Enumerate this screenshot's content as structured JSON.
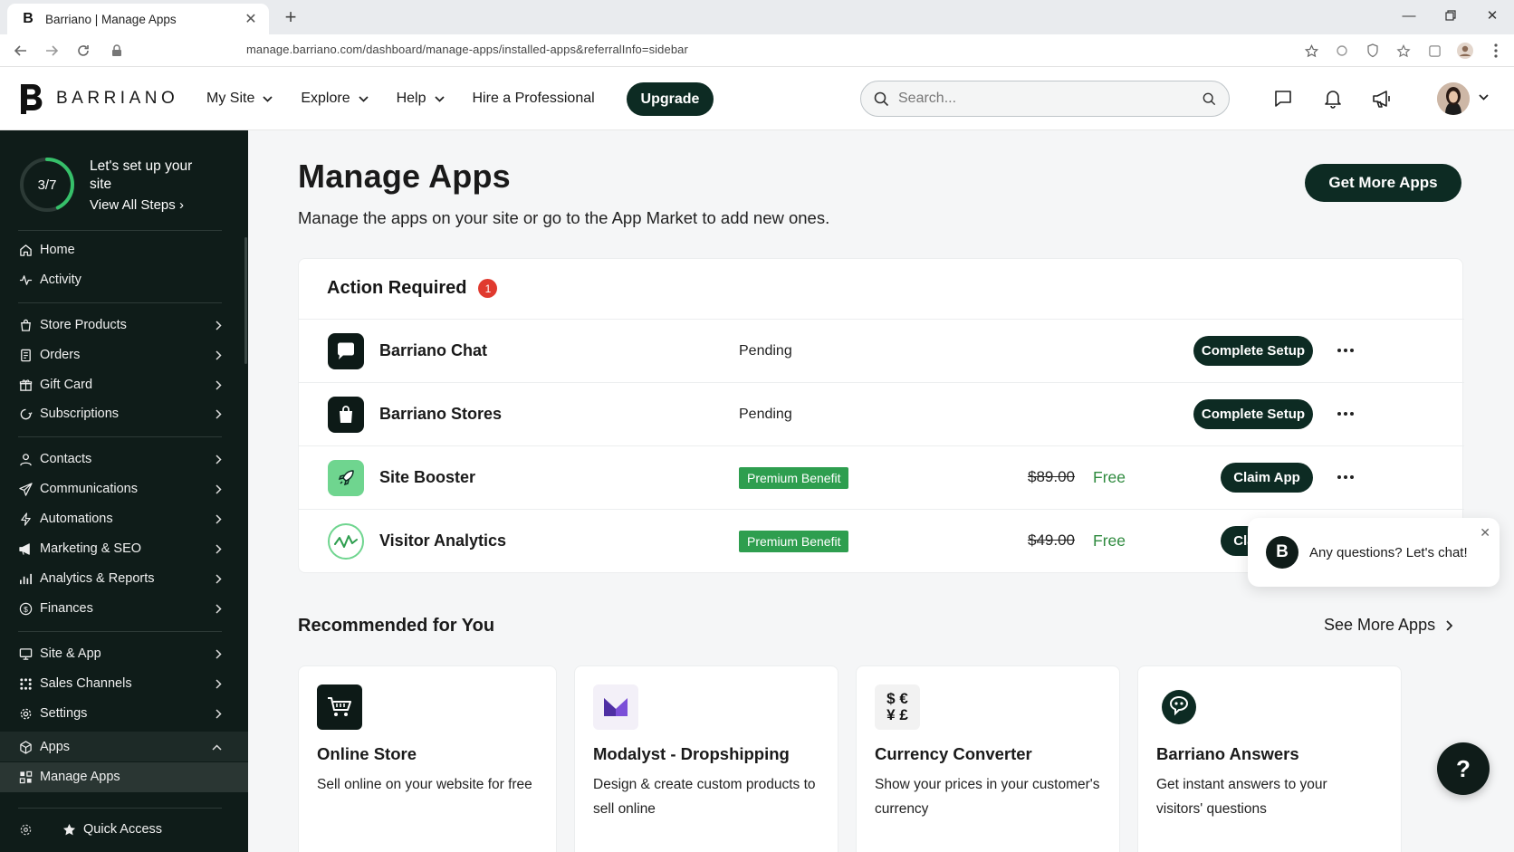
{
  "browser": {
    "tab_title": "Barriano | Manage Apps",
    "tab_favicon": "B",
    "url": "manage.barriano.com/dashboard/manage-apps/installed-apps&referralInfo=sidebar",
    "new_tab": "+"
  },
  "header": {
    "logo_text": "BARRIANO",
    "nav": [
      {
        "label": "My Site",
        "has_chevron": true
      },
      {
        "label": "Explore",
        "has_chevron": true
      },
      {
        "label": "Help",
        "has_chevron": true
      },
      {
        "label": "Hire a Professional",
        "has_chevron": false
      }
    ],
    "upgrade_label": "Upgrade",
    "search_placeholder": "Search..."
  },
  "sidebar": {
    "progress_text": "3/7",
    "progress_fraction": 0.43,
    "setup_title": "Let's set up your site",
    "setup_link": "View All Steps",
    "items": [
      {
        "label": "Home",
        "icon": "home-icon"
      },
      {
        "label": "Activity",
        "icon": "activity-icon"
      },
      {
        "label": "Store Products",
        "icon": "bag-icon"
      },
      {
        "label": "Orders",
        "icon": "receipt-icon"
      },
      {
        "label": "Gift Card",
        "icon": "gift-icon"
      },
      {
        "label": "Subscriptions",
        "icon": "refresh-icon"
      },
      {
        "label": "Contacts",
        "icon": "person-icon"
      },
      {
        "label": "Communications",
        "icon": "send-icon"
      },
      {
        "label": "Automations",
        "icon": "bolt-icon"
      },
      {
        "label": "Marketing & SEO",
        "icon": "megaphone-icon"
      },
      {
        "label": "Analytics & Reports",
        "icon": "bar-chart-icon"
      },
      {
        "label": "Finances",
        "icon": "dollar-circle-icon"
      },
      {
        "label": "Site & App",
        "icon": "monitor-icon"
      },
      {
        "label": "Sales Channels",
        "icon": "channels-icon"
      },
      {
        "label": "Settings",
        "icon": "gear-icon"
      },
      {
        "label": "Apps",
        "icon": "cube-icon"
      },
      {
        "label": "Manage Apps",
        "icon": "manage-apps-icon"
      }
    ],
    "quick_access": "Quick Access"
  },
  "main": {
    "title": "Manage Apps",
    "subtitle": "Manage the apps on your site or go to the App Market to add new ones.",
    "get_more_label": "Get More Apps",
    "action_required": {
      "heading": "Action Required",
      "count": "1",
      "rows": [
        {
          "name": "Barriano Chat",
          "status": "Pending",
          "button": "Complete Setup"
        },
        {
          "name": "Barriano Stores",
          "status": "Pending",
          "button": "Complete Setup"
        },
        {
          "name": "Site Booster",
          "badge": "Premium Benefit",
          "old_price": "$89.00",
          "price": "Free",
          "button": "Claim App"
        },
        {
          "name": "Visitor Analytics",
          "badge": "Premium Benefit",
          "old_price": "$49.00",
          "price": "Free",
          "button": "Claim App"
        }
      ]
    },
    "recommended": {
      "heading": "Recommended for You",
      "see_more": "See More Apps",
      "cards": [
        {
          "name": "Online Store",
          "desc": "Sell online on your website for free"
        },
        {
          "name": "Modalyst - Dropshipping",
          "desc": "Design & create custom products to sell online"
        },
        {
          "name": "Currency Converter",
          "desc": "Show your prices in your customer's currency",
          "icon_text": "$ € ¥ £"
        },
        {
          "name": "Barriano Answers",
          "desc": "Get instant answers to your visitors' questions"
        }
      ]
    },
    "chat_popup": "Any questions? Let's chat!",
    "help_label": "?"
  },
  "colors": {
    "brand_dark": "#0d2b23",
    "sidebar_bg": "#0f1c19",
    "premium_green": "#2e9e4f",
    "free_green": "#2e8a3e",
    "alert_red": "#e03a2f",
    "progress_green": "#36c06a"
  }
}
